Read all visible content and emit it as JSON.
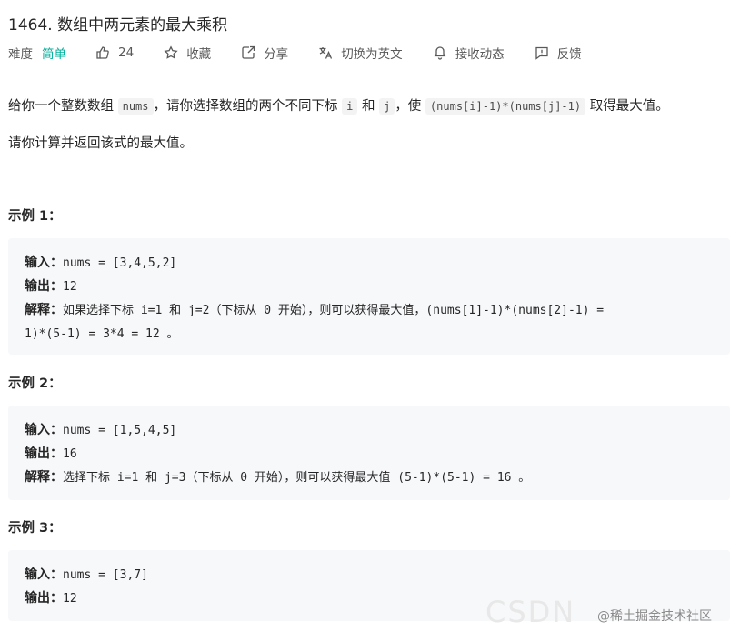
{
  "problem": {
    "title": "1464. 数组中两元素的最大乘积"
  },
  "toolbar": {
    "difficulty_label": "难度",
    "difficulty_value": "简单",
    "likes": "24",
    "favorite": "收藏",
    "share": "分享",
    "switch_lang": "切换为英文",
    "notify": "接收动态",
    "feedback": "反馈"
  },
  "description": {
    "p1_a": "给你一个整数数组",
    "p1_code1": "nums",
    "p1_b": "，请你选择数组的两个不同下标",
    "p1_code2": "i",
    "p1_c": "和",
    "p1_code3": "j",
    "p1_d": "，使",
    "p1_code4": "(nums[i]-1)*(nums[j]-1)",
    "p1_e": "取得最大值。",
    "p2": "请你计算并返回该式的最大值。"
  },
  "examples": [
    {
      "title": "示例 1：",
      "input_label": "输入：",
      "input": "nums = [3,4,5,2]",
      "output_label": "输出：",
      "output": "12",
      "explain_label": "解释：",
      "explain_1": "如果选择下标 i=1 和 j=2（下标从 0 开始），则可以获得最大值，(nums[1]-1)*(nums[2]-1) =",
      "explain_2": "1)*(5-1) = 3*4 = 12 。"
    },
    {
      "title": "示例 2：",
      "input_label": "输入：",
      "input": "nums = [1,5,4,5]",
      "output_label": "输出：",
      "output": "16",
      "explain_label": "解释：",
      "explain_1": "选择下标 i=1 和 j=3（下标从 0 开始），则可以获得最大值 (5-1)*(5-1) = 16 。"
    },
    {
      "title": "示例 3：",
      "input_label": "输入：",
      "input": "nums = [3,7]",
      "output_label": "输出：",
      "output": "12"
    }
  ],
  "watermark": {
    "csdn": "CSDN",
    "text": "@稀土掘金技术社区"
  },
  "colors": {
    "difficulty_easy": "#00af9b",
    "example_bg": "#f7f8fa",
    "code_bg": "#f3f3f3"
  }
}
